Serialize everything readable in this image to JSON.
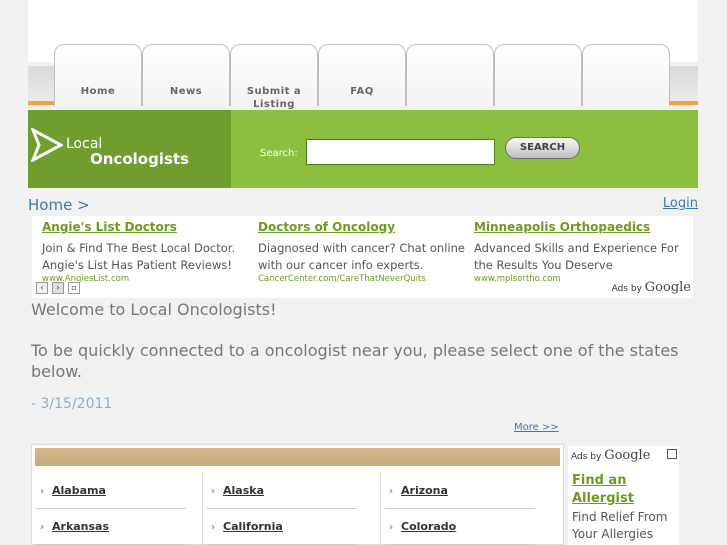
{
  "nav": {
    "tabs": [
      {
        "label": "Home"
      },
      {
        "label": "News"
      },
      {
        "label": "Submit a Listing"
      },
      {
        "label": "FAQ"
      },
      {
        "label": ""
      },
      {
        "label": ""
      },
      {
        "label": ""
      }
    ]
  },
  "banner": {
    "logo_line1": "Local",
    "logo_line2": "Oncologists",
    "search_label": "Search:",
    "search_value": "",
    "search_button": "SEARCH",
    "colors": {
      "green": "#8cbf40",
      "dark_green": "#6f9e2e",
      "orange": "#f0a14a"
    }
  },
  "breadcrumb": "Home >",
  "login": "Login",
  "ads": {
    "items": [
      {
        "title": "Angie's List Doctors",
        "desc": "Join & Find The Best Local Doctor. Angie's List Has Patient Reviews!",
        "url": "www.AngiesList.com"
      },
      {
        "title": "Doctors of Oncology",
        "desc": "Diagnosed with cancer? Chat online with our cancer info experts.",
        "url": "CancerCenter.com/CareThatNeverQuits"
      },
      {
        "title": "Minneapolis Orthopaedics",
        "desc": "Advanced Skills and Experience For the Results You Deserve",
        "url": "www.mplsortho.com"
      }
    ],
    "ads_by": "Ads by",
    "google": "Google",
    "prev_icon": "chevron-left-icon",
    "next_icon": "chevron-right-icon"
  },
  "welcome": {
    "line1": "Welcome to Local Oncologists!",
    "line2": "To be quickly connected to a oncologist near you, please select one of the states below.",
    "date": "- 3/15/2011"
  },
  "more": "More >>",
  "states": {
    "col1": [
      "Alabama",
      "Arkansas"
    ],
    "col2": [
      "Alaska",
      "California"
    ],
    "col3": [
      "Arizona",
      "Colorado"
    ]
  },
  "right_ad": {
    "ads_by": "Ads by",
    "google": "Google",
    "title": "Find an Allergist",
    "desc": "Find Relief From Your Allergies"
  }
}
